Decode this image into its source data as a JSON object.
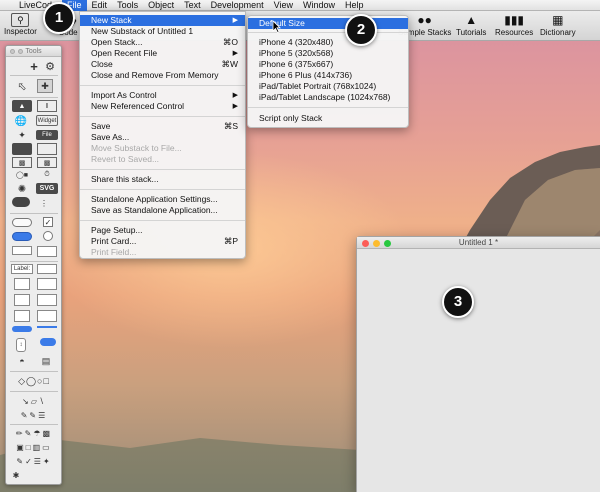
{
  "menubar": {
    "apple": "",
    "items": [
      "LiveCode",
      "File",
      "Edit",
      "Tools",
      "Object",
      "Text",
      "Development",
      "View",
      "Window",
      "Help"
    ],
    "active": "File"
  },
  "toolbar": {
    "inspector": "Inspector",
    "code": "Code",
    "sample_stacks": "Sample Stacks",
    "tutorials": "Tutorials",
    "resources": "Resources",
    "dictionary": "Dictionary"
  },
  "tools_palette": {
    "title": "Tools",
    "widget_label": "Widget",
    "file_label": "File",
    "svg_label": "SVG",
    "label_label": "Label:"
  },
  "file_menu": {
    "items": [
      {
        "label": "New Stack",
        "shortcut": "",
        "submenu": true,
        "highlighted": true,
        "disabled": false
      },
      {
        "label": "New Substack of Untitled 1",
        "shortcut": "",
        "submenu": false,
        "disabled": false
      },
      {
        "label": "Open Stack...",
        "shortcut": "⌘O",
        "submenu": false,
        "disabled": false
      },
      {
        "label": "Open Recent File",
        "shortcut": "",
        "submenu": true,
        "disabled": false
      },
      {
        "label": "Close",
        "shortcut": "⌘W",
        "submenu": false,
        "disabled": false
      },
      {
        "label": "Close and Remove From Memory",
        "shortcut": "",
        "submenu": false,
        "disabled": false
      },
      {
        "label": "Import As Control",
        "shortcut": "",
        "submenu": true,
        "disabled": false
      },
      {
        "label": "New Referenced Control",
        "shortcut": "",
        "submenu": true,
        "disabled": false
      },
      {
        "label": "Save",
        "shortcut": "⌘S",
        "submenu": false,
        "disabled": false
      },
      {
        "label": "Save As...",
        "shortcut": "",
        "submenu": false,
        "disabled": false
      },
      {
        "label": "Move Substack to File...",
        "shortcut": "",
        "submenu": false,
        "disabled": true
      },
      {
        "label": "Revert to Saved...",
        "shortcut": "",
        "submenu": false,
        "disabled": true
      },
      {
        "label": "Share this stack...",
        "shortcut": "",
        "submenu": false,
        "disabled": false
      },
      {
        "label": "Standalone Application Settings...",
        "shortcut": "",
        "submenu": false,
        "disabled": false
      },
      {
        "label": "Save as Standalone Application...",
        "shortcut": "",
        "submenu": false,
        "disabled": false
      },
      {
        "label": "Page Setup...",
        "shortcut": "",
        "submenu": false,
        "disabled": false
      },
      {
        "label": "Print Card...",
        "shortcut": "⌘P",
        "submenu": false,
        "disabled": false
      },
      {
        "label": "Print Field...",
        "shortcut": "",
        "submenu": false,
        "disabled": true
      }
    ]
  },
  "new_stack_submenu": {
    "items": [
      {
        "label": "Default Size",
        "highlighted": true
      },
      {
        "label": "iPhone 4 (320x480)"
      },
      {
        "label": "iPhone 5 (320x568)"
      },
      {
        "label": "iPhone 6 (375x667)"
      },
      {
        "label": "iPhone 6 Plus (414x736)"
      },
      {
        "label": "iPad/Tablet Portrait (768x1024)"
      },
      {
        "label": "iPad/Tablet Landscape (1024x768)"
      },
      {
        "label": "Script only Stack"
      }
    ]
  },
  "untitled_window": {
    "title": "Untitled 1 *"
  },
  "callouts": [
    "1",
    "2",
    "3"
  ],
  "colors": {
    "highlight": "#2b6fe0",
    "close": "#fc5d57",
    "minimize": "#fdbc2e",
    "zoom": "#28c840"
  }
}
